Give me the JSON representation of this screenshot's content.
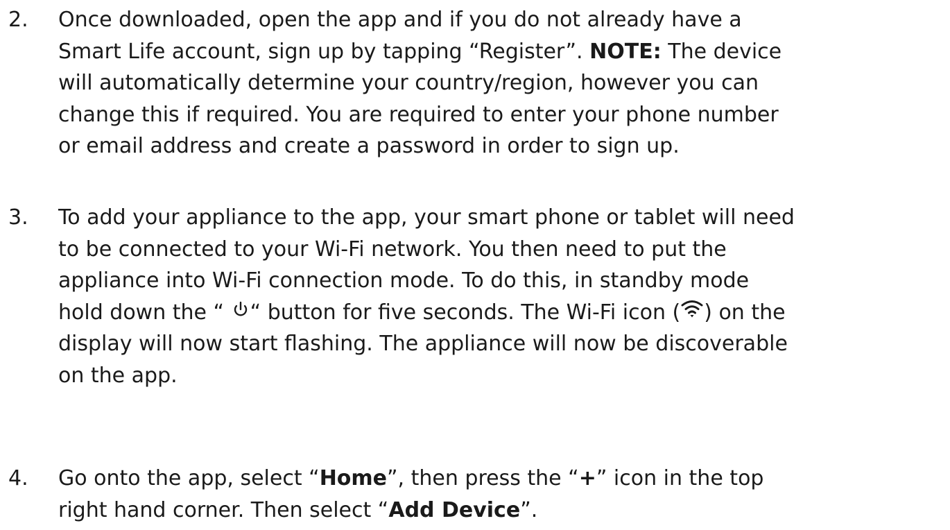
{
  "steps": [
    {
      "number": "2.",
      "lines": [
        [
          "Once downloaded, open the app and if you do not already have a"
        ],
        [
          "Smart Life account, sign up by tapping “Register”. ",
          "NOTE:",
          " The device"
        ],
        [
          "will automatically determine your country/region, however you can"
        ],
        [
          "change this if required. You are required to enter your phone number"
        ],
        [
          "or email address and create a password in order to sign up."
        ]
      ]
    },
    {
      "number": "3.",
      "lines": [
        [
          "To add your appliance to the app, your smart phone or tablet will need"
        ],
        [
          "to be connected to your Wi-Fi network. You then need to put the"
        ],
        [
          "appliance into Wi-Fi connection mode. To do this, in standby mode"
        ],
        [
          "hold down the “ ",
          "“ button for five seconds. The Wi-Fi icon  (",
          ") on the"
        ],
        [
          "display will now start flashing. The appliance will now be discoverable"
        ],
        [
          "on the app."
        ]
      ]
    },
    {
      "number": "4.",
      "lines": [
        [
          "Go onto the app, select “",
          "Home",
          "”, then press the “",
          "+",
          "” icon in the top"
        ],
        [
          "right hand corner. Then select “",
          "Add Device",
          "”."
        ]
      ]
    }
  ],
  "icons": {
    "power": "power-icon",
    "wifi": "wifi-icon"
  }
}
